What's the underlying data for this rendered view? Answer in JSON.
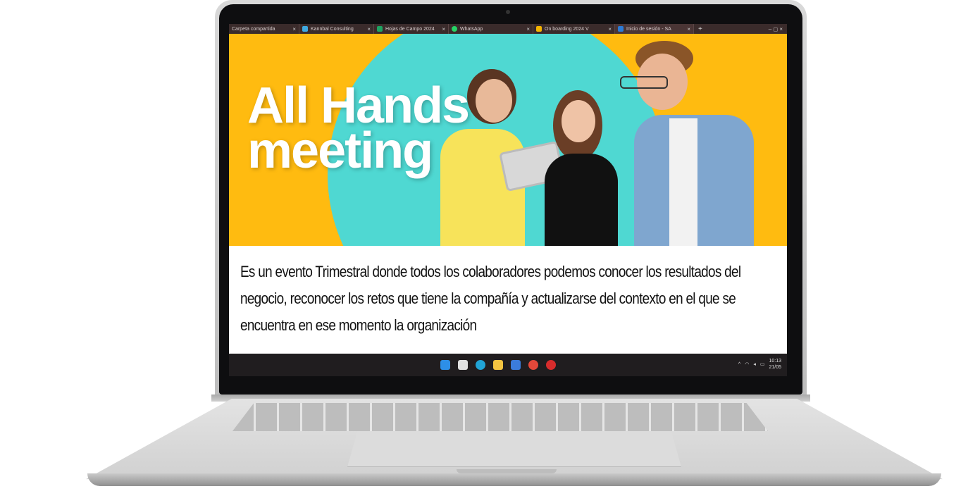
{
  "browser": {
    "tabs": [
      {
        "label": "Carpeta compartida",
        "favicon_color": "#3a2b2b",
        "active": false
      },
      {
        "label": "Kannbal Consulting",
        "favicon_color": "#3fa9e0",
        "active": false
      },
      {
        "label": "Hojas de Campo 2024",
        "favicon_color": "#1ea362",
        "active": false
      },
      {
        "label": "WhatsApp",
        "favicon_color": "#25d366",
        "active": false
      },
      {
        "label": "On boarding 2024 V",
        "favicon_color": "#f4b400",
        "active": false
      },
      {
        "label": "Inicio de sesión - SA",
        "favicon_color": "#2b7bd6",
        "active": true
      }
    ],
    "close_glyph": "×",
    "new_tab_glyph": "+",
    "window_controls": "–  ◻  ×"
  },
  "banner": {
    "headline": "All Hands\nmeeting",
    "colors": {
      "background": "#ffbb10",
      "circle": "#4fd8d2",
      "headline": "#ffffff"
    }
  },
  "content": {
    "description": "Es un evento Trimestral donde todos los colaboradores podemos conocer los resultados del negocio, reconocer los retos que tiene la compañía y actualizarse del contexto en el que se encuentra en ese momento la organización"
  },
  "taskbar": {
    "icons": [
      "windows-start-icon",
      "apps-icon",
      "edge-icon",
      "file-explorer-icon",
      "store-icon",
      "chrome-icon",
      "opera-icon"
    ],
    "tray_glyphs": "^",
    "clock_time": "10:13",
    "clock_date": "21/05"
  }
}
